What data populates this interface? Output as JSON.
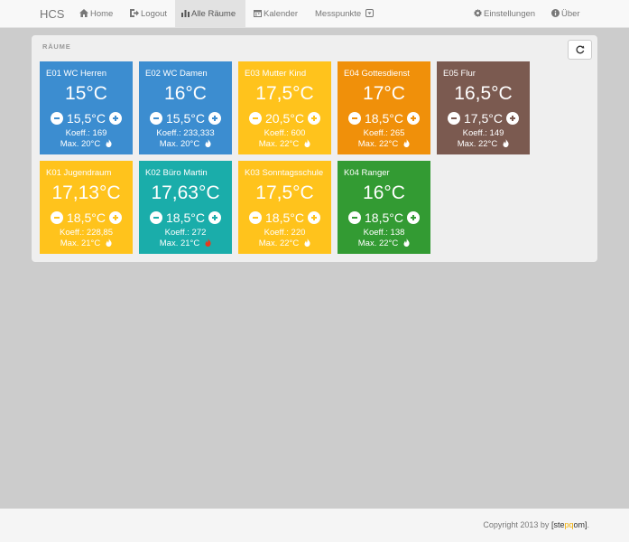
{
  "navbar": {
    "brand": "HCS",
    "items": [
      {
        "label": "Home",
        "icon": "home-icon"
      },
      {
        "label": "Logout",
        "icon": "logout-icon"
      },
      {
        "label": "Alle Räume",
        "icon": "bar-chart-icon",
        "active": true
      },
      {
        "label": "Kalender",
        "icon": "calendar-icon"
      },
      {
        "label": "Messpunkte",
        "icon": "dropdown-caret-icon"
      },
      {
        "label": "Einstellungen",
        "icon": "gear-icon"
      },
      {
        "label": "Über",
        "icon": "info-icon"
      }
    ]
  },
  "panel": {
    "title": "RÄUME",
    "refresh_icon": "refresh-icon"
  },
  "colors": {
    "blue": "#3c8dd0",
    "yellow": "#ffc31c",
    "orange": "#f0900a",
    "brown": "#7b5a50",
    "teal": "#1aadaa",
    "green": "#339b33",
    "flame_active": "#e8391b"
  },
  "rooms": [
    {
      "name": "E01 WC Herren",
      "temp": "15°C",
      "setpoint": "15,5°C",
      "koeff": "Koeff.: 169",
      "max": "Max. 20°C",
      "color": "blue",
      "heating": false
    },
    {
      "name": "E02 WC Damen",
      "temp": "16°C",
      "setpoint": "15,5°C",
      "koeff": "Koeff.: 233,333",
      "max": "Max. 20°C",
      "color": "blue",
      "heating": false
    },
    {
      "name": "E03 Mutter Kind",
      "temp": "17,5°C",
      "setpoint": "20,5°C",
      "koeff": "Koeff.: 600",
      "max": "Max. 22°C",
      "color": "yellow",
      "heating": false
    },
    {
      "name": "E04 Gottesdienst",
      "temp": "17°C",
      "setpoint": "18,5°C",
      "koeff": "Koeff.: 265",
      "max": "Max. 22°C",
      "color": "orange",
      "heating": false
    },
    {
      "name": "E05 Flur",
      "temp": "16,5°C",
      "setpoint": "17,5°C",
      "koeff": "Koeff.: 149",
      "max": "Max. 22°C",
      "color": "brown",
      "heating": false
    },
    {
      "name": "K01 Jugendraum",
      "temp": "17,13°C",
      "setpoint": "18,5°C",
      "koeff": "Koeff.: 228,85",
      "max": "Max. 21°C",
      "color": "yellow",
      "heating": false
    },
    {
      "name": "K02 Büro Martin",
      "temp": "17,63°C",
      "setpoint": "18,5°C",
      "koeff": "Koeff.: 272",
      "max": "Max. 21°C",
      "color": "teal",
      "heating": true
    },
    {
      "name": "K03 Sonntagsschule",
      "temp": "17,5°C",
      "setpoint": "18,5°C",
      "koeff": "Koeff.: 220",
      "max": "Max. 22°C",
      "color": "yellow",
      "heating": false
    },
    {
      "name": "K04 Ranger",
      "temp": "16°C",
      "setpoint": "18,5°C",
      "koeff": "Koeff.: 138",
      "max": "Max. 22°C",
      "color": "green",
      "heating": false
    }
  ],
  "footer": {
    "prefix": "Copyright 2013 by ",
    "brand_open": "[ste",
    "brand_accent": "pq",
    "brand_close": "om]",
    "suffix": "."
  }
}
